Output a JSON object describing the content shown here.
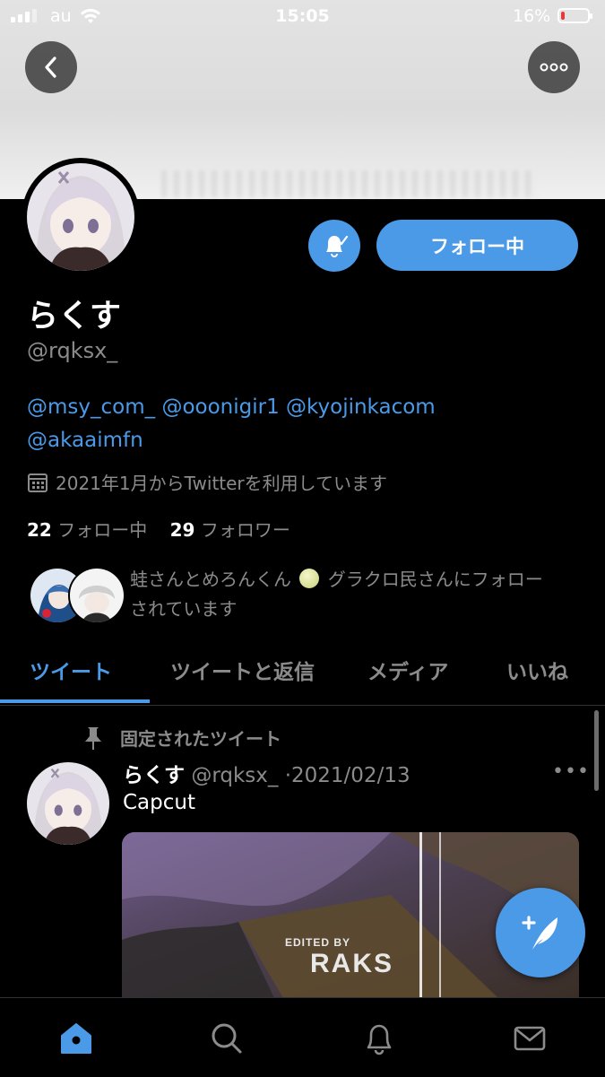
{
  "status_bar": {
    "carrier": "au",
    "time": "15:05",
    "battery": "16%",
    "battery_level": 0.16
  },
  "colors": {
    "accent": "#4a9ae8",
    "background": "#000000",
    "secondary_text": "#8b8b8b",
    "battery_low": "#e53935"
  },
  "icons": {
    "back": "chevron-left-icon",
    "more": "ellipsis-icon",
    "bell": "bell-check-icon",
    "calendar": "calendar-icon",
    "pin": "pin-icon",
    "compose": "feather-plus-icon",
    "home": "home-icon",
    "search": "search-icon",
    "notifications": "bell-icon",
    "messages": "mail-icon"
  },
  "profile": {
    "follow_button": "フォロー中",
    "display_name": "らくす",
    "handle": "@rqksx_",
    "bio_mentions": [
      "@msy_com_",
      "@ooonigir1",
      "@kyojinkacom",
      "@akaaimfn"
    ],
    "joined": "2021年1月からTwitterを利用しています",
    "following_count": "22",
    "following_label": "フォロー中",
    "followers_count": "29",
    "followers_label": "フォロワー",
    "followed_by_pre": "蛙さんとめろんくん",
    "followed_by_post": "グラクロ民さんにフォロー",
    "followed_by_line2": "されています"
  },
  "tabs": [
    {
      "label": "ツイート",
      "active": true
    },
    {
      "label": "ツイートと返信",
      "active": false
    },
    {
      "label": "メディア",
      "active": false
    },
    {
      "label": "いいね",
      "active": false
    }
  ],
  "pinned_tweet": {
    "pinned_label": "固定されたツイート",
    "name": "らくす",
    "handle": "@rqksx_",
    "separator": "·",
    "date": "2021/02/13",
    "more": "•••",
    "text": "Capcut",
    "media_overlay_small": "EDITED BY",
    "media_overlay_large": "RAKS"
  }
}
